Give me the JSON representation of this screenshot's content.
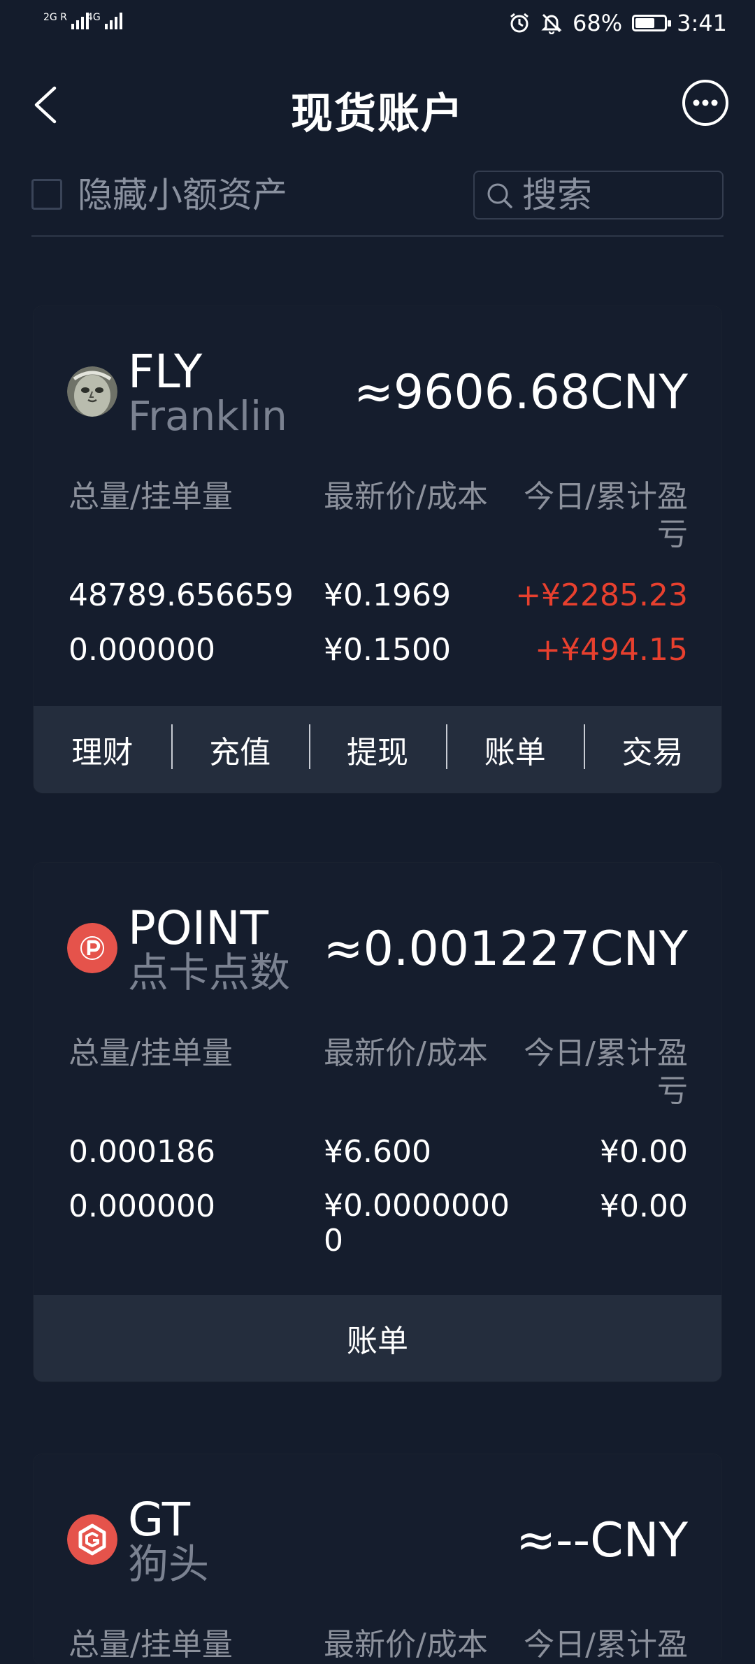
{
  "status_bar": {
    "network_left": "2G R",
    "network_right": "4G",
    "battery": "68%",
    "time": "3:41",
    "battery_level": 0.68
  },
  "header": {
    "title": "现货账户"
  },
  "filter": {
    "hide_small_label": "隐藏小额资产",
    "search_placeholder": "搜索"
  },
  "cards": [
    {
      "symbol": "FLY",
      "name": "Franklin",
      "value": "≈9606.68CNY",
      "headers": [
        "总量/挂单量",
        "最新价/成本",
        "今日/累计盈\n亏"
      ],
      "rows": [
        [
          "48789.656659",
          "¥0.1969",
          "+¥2285.23"
        ],
        [
          "0.000000",
          "¥0.1500",
          "+¥494.15"
        ]
      ],
      "actions": [
        "理财",
        "充值",
        "提现",
        "账单",
        "交易"
      ]
    },
    {
      "symbol": "POINT",
      "name": "点卡点数",
      "value": "≈0.001227CNY",
      "headers": [
        "总量/挂单量",
        "最新价/成本",
        "今日/累计盈\n亏"
      ],
      "rows": [
        [
          "0.000186",
          "¥6.600",
          "¥0.00"
        ],
        [
          "0.000000",
          "¥0.0000000\n0",
          "¥0.00"
        ]
      ],
      "actions": [
        "账单"
      ]
    },
    {
      "symbol": "GT",
      "name": "狗头",
      "value": "≈--CNY",
      "headers": [
        "总量/挂单量",
        "最新价/成本",
        "今日/累计盈"
      ]
    }
  ],
  "colors": {
    "background": "#141c2c",
    "profit_red": "#e8402e",
    "action_bar": "#242d3d"
  }
}
